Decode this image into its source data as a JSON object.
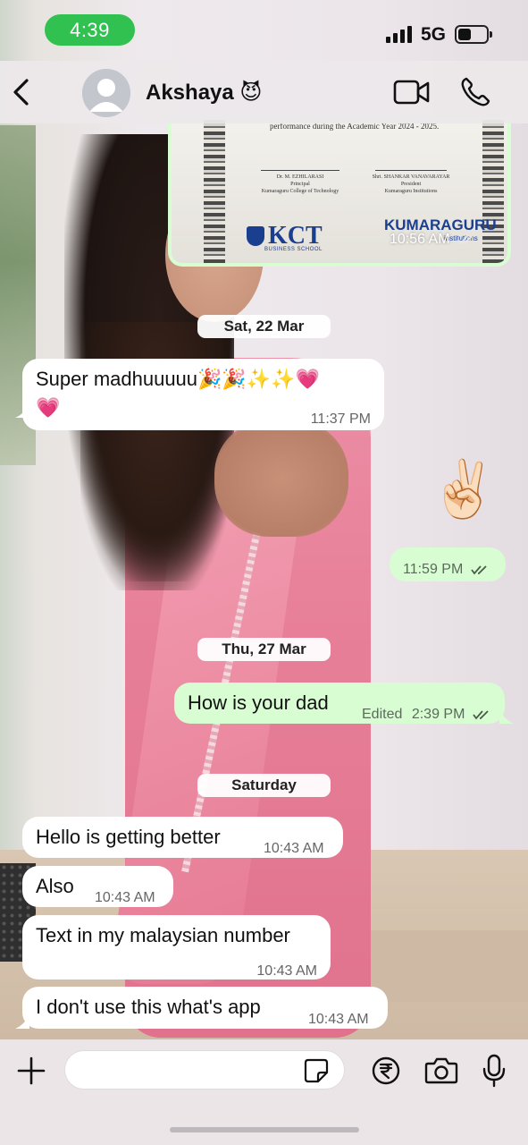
{
  "status_bar": {
    "time": "4:39",
    "network": "5G",
    "battery_level": 0.45
  },
  "header": {
    "contact_name": "Akshaya 😈",
    "icons": [
      "back-chevron-icon",
      "video-call-icon",
      "phone-icon"
    ]
  },
  "certificate": {
    "text_line": "performance during the Academic Year 2024 - 2025.",
    "signatory1_name": "Dr. M. EZHILARASI",
    "signatory1_title": "Principal",
    "signatory1_org": "Kumaraguru College of Technology",
    "signatory2_name": "Shri. SHANKAR VANAVARAYAR",
    "signatory2_title": "President",
    "signatory2_org": "Kumaraguru Institutions",
    "logo1": "KCT",
    "logo1_sub": "BUSINESS SCHOOL",
    "logo2": "KUMARAGURU",
    "logo2_sub": "institutions",
    "time": "10:56 AM"
  },
  "date_chips": {
    "d1": "Sat, 22 Mar",
    "d2": "Thu, 27 Mar",
    "d3": "Saturday"
  },
  "messages": [
    {
      "direction": "in",
      "text": "Super madhuuuuu🎉🎉✨✨💗",
      "text2": "💗",
      "time": "11:37 PM"
    },
    {
      "direction": "out",
      "text": "✌🏻",
      "time": "11:59 PM",
      "status": "read"
    },
    {
      "direction": "out",
      "text": "How is your dad",
      "edited": "Edited",
      "time": "2:39 PM",
      "status": "read"
    },
    {
      "direction": "in",
      "text": "Hello is getting better",
      "time": "10:43 AM"
    },
    {
      "direction": "in",
      "text": "Also",
      "time": "10:43 AM"
    },
    {
      "direction": "in",
      "text": "Text in my malaysian number",
      "time": "10:43 AM"
    },
    {
      "direction": "in",
      "text": "I don't use this what's app",
      "time": "10:43 AM"
    }
  ],
  "input_bar": {
    "placeholder": "",
    "icons": [
      "plus-icon",
      "sticker-icon",
      "rupee-icon",
      "camera-icon",
      "microphone-icon"
    ]
  },
  "colors": {
    "status_pill": "#30c150",
    "outgoing_bubble": "#d9fdd3",
    "incoming_bubble": "#ffffff",
    "read_ticks": "#53bdeb"
  }
}
